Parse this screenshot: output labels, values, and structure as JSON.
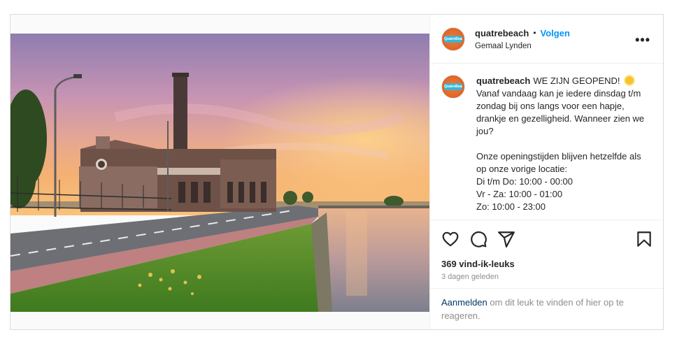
{
  "account": {
    "username": "quatrebeach",
    "avatar_text": "QuatreBeach",
    "location": "Gemaal Lynden",
    "separator": "•",
    "follow_label": "Volgen",
    "more_label": "•••"
  },
  "caption": {
    "username": "quatrebeach",
    "text": "WE ZIJN GEOPEND! ",
    "emoji": "sun-emoji",
    "body": "Vanaf vandaag kan je iedere dinsdag t/m zondag bij ons langs voor een hapje, drankje en gezelligheid. Wanneer zien we jou?\n\nOnze openingstijden blijven hetzelfde als op onze vorige locatie:\nDi t/m Do: 10:00 - 00:00\nVr - Za: 10:00 - 01:00\nZo: 10:00 - 23:00"
  },
  "actions": {
    "icons": [
      "heart-icon",
      "comment-icon",
      "share-icon",
      "save-icon"
    ]
  },
  "stats": {
    "likes": "369 vind-ik-leuks",
    "date": "3 dagen geleden"
  },
  "footer": {
    "login_link": "Aanmelden",
    "login_text": " om dit leuk te vinden of hier op te reageren."
  },
  "colors": {
    "accent": "#0095f6",
    "text": "#262626",
    "muted": "#8e8e8e",
    "border": "#dbdbdb"
  }
}
